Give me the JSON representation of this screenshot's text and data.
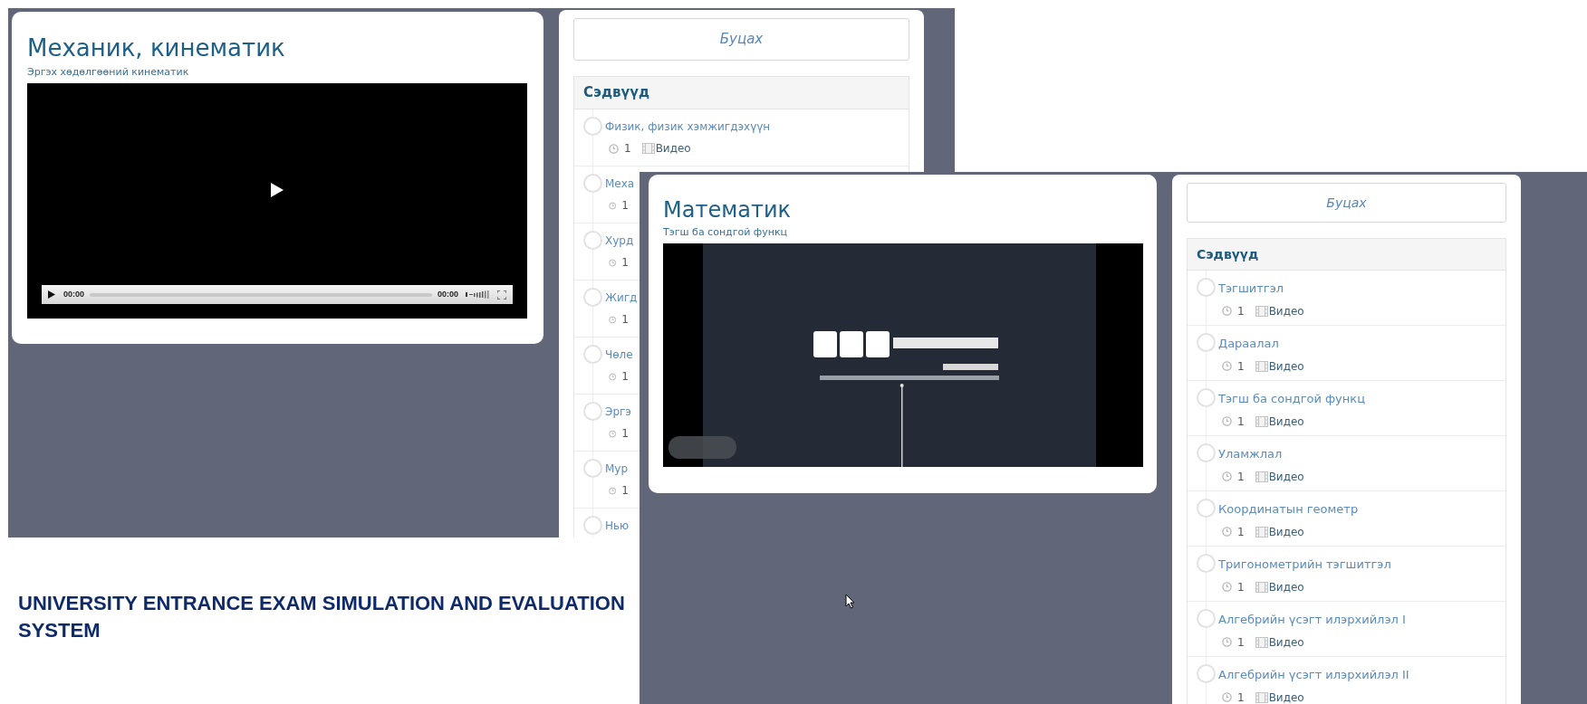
{
  "screenshots": [
    {
      "main": {
        "title": "Механик, кинематик",
        "subtitle": "Эргэх хөдөлгөөний кинематик",
        "video": {
          "kind": "player",
          "elapsed": "00:00",
          "duration": "00:00"
        }
      },
      "sidebar": {
        "back_button": "Буцах",
        "heading": "Сэдвүүд",
        "topics": [
          {
            "title": "Физик, физик хэмжигдэхүүн",
            "count": "1",
            "type": "Видео"
          },
          {
            "title": "Меха",
            "count": "1"
          },
          {
            "title": "Хурд",
            "count": "1"
          },
          {
            "title": "Жигд",
            "count": "1"
          },
          {
            "title": "Чөле",
            "count": "1"
          },
          {
            "title": "Эргэ",
            "count": "1"
          },
          {
            "title": "Мур",
            "count": "1"
          },
          {
            "title": "Нью"
          }
        ]
      }
    },
    {
      "main": {
        "title": "Математик",
        "subtitle": "Тэгш ба сондгой функц"
      },
      "sidebar": {
        "back_button": "Буцах",
        "heading": "Сэдвүүд",
        "topics": [
          {
            "title": "Тэгшитгэл",
            "count": "1",
            "type": "Видео"
          },
          {
            "title": "Дараалал",
            "count": "1",
            "type": "Видео"
          },
          {
            "title": "Тэгш ба сондгой функц",
            "count": "1",
            "type": "Видео"
          },
          {
            "title": "Уламжлал",
            "count": "1",
            "type": "Видео"
          },
          {
            "title": "Координатын геометр",
            "count": "1",
            "type": "Видео"
          },
          {
            "title": "Тригонометрийн тэгшитгэл",
            "count": "1",
            "type": "Видео"
          },
          {
            "title": "Алгебрийн үсэгт илэрхийлэл I",
            "count": "1",
            "type": "Видео"
          },
          {
            "title": "Алгебрийн үсэгт илэрхийлэл II",
            "count": "1",
            "type": "Видео"
          }
        ]
      }
    }
  ],
  "caption": "UNIVERSITY ENTRANCE EXAM SIMULATION AND EVALUATION SYSTEM"
}
